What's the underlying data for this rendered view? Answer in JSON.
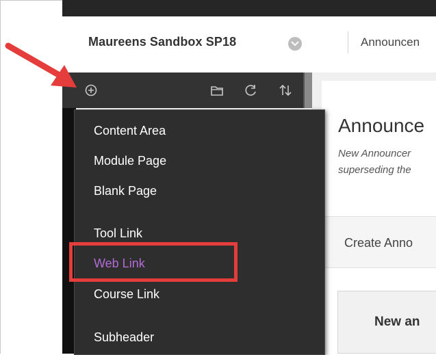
{
  "header": {
    "course_title": "Maureens Sandbox SP18",
    "breadcrumb": "Announcen"
  },
  "toolbar": {
    "icons": [
      "add-menu-icon",
      "folder-icon",
      "refresh-icon",
      "sort-icon"
    ]
  },
  "menu": {
    "items": [
      {
        "label": "Content Area"
      },
      {
        "label": "Module Page"
      },
      {
        "label": "Blank Page"
      },
      {
        "label": "Tool Link"
      },
      {
        "label": "Web Link",
        "highlighted": true
      },
      {
        "label": "Course Link"
      },
      {
        "label": "Subheader"
      }
    ]
  },
  "main": {
    "title": "Announce",
    "description_lines": [
      "New Announcer",
      "superseding the"
    ],
    "create_button": "Create Anno",
    "new_box": "New an"
  },
  "colors": {
    "highlight": "#e53c3c",
    "active_item": "#b36bd6",
    "menu_bg": "#2e2e2e"
  }
}
